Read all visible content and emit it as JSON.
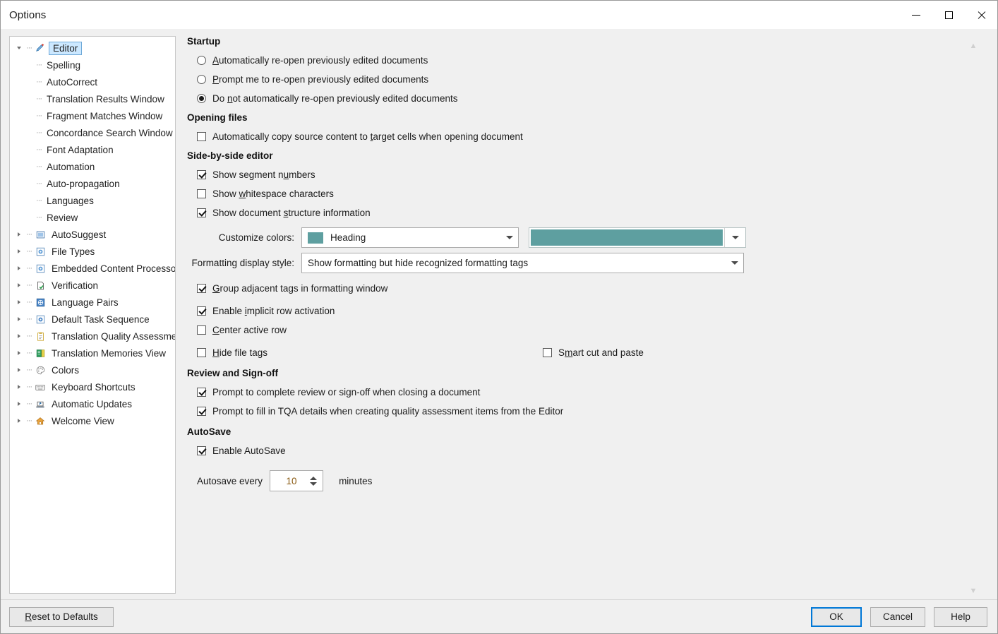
{
  "window": {
    "title": "Options",
    "minimize_label": "Minimize",
    "maximize_label": "Maximize",
    "close_label": "Close"
  },
  "sidebar": {
    "items": [
      {
        "label": "Editor",
        "icon": "pencil-icon",
        "level": 0,
        "state": "expanded",
        "selected": true
      },
      {
        "label": "Spelling",
        "icon": "none",
        "level": 1,
        "state": "leaf",
        "selected": false
      },
      {
        "label": "AutoCorrect",
        "icon": "none",
        "level": 1,
        "state": "leaf",
        "selected": false
      },
      {
        "label": "Translation Results Window",
        "icon": "none",
        "level": 1,
        "state": "leaf",
        "selected": false
      },
      {
        "label": "Fragment Matches Window",
        "icon": "none",
        "level": 1,
        "state": "leaf",
        "selected": false
      },
      {
        "label": "Concordance Search Window",
        "icon": "none",
        "level": 1,
        "state": "leaf",
        "selected": false
      },
      {
        "label": "Font Adaptation",
        "icon": "none",
        "level": 1,
        "state": "leaf",
        "selected": false
      },
      {
        "label": "Automation",
        "icon": "none",
        "level": 1,
        "state": "leaf",
        "selected": false
      },
      {
        "label": "Auto-propagation",
        "icon": "none",
        "level": 1,
        "state": "leaf",
        "selected": false
      },
      {
        "label": "Languages",
        "icon": "none",
        "level": 1,
        "state": "leaf",
        "selected": false
      },
      {
        "label": "Review",
        "icon": "none",
        "level": 1,
        "state": "leaf",
        "selected": false
      },
      {
        "label": "AutoSuggest",
        "icon": "autosuggest-icon",
        "level": 0,
        "state": "collapsed",
        "selected": false
      },
      {
        "label": "File Types",
        "icon": "file-types-icon",
        "level": 0,
        "state": "collapsed",
        "selected": false
      },
      {
        "label": "Embedded Content Processor",
        "icon": "embedded-content-icon",
        "level": 0,
        "state": "collapsed",
        "selected": false
      },
      {
        "label": "Verification",
        "icon": "verification-icon",
        "level": 0,
        "state": "collapsed",
        "selected": false
      },
      {
        "label": "Language Pairs",
        "icon": "language-pairs-icon",
        "level": 0,
        "state": "collapsed",
        "selected": false
      },
      {
        "label": "Default Task Sequence",
        "icon": "task-sequence-icon",
        "level": 0,
        "state": "collapsed",
        "selected": false
      },
      {
        "label": "Translation Quality Assessmen",
        "icon": "tqa-icon",
        "level": 0,
        "state": "collapsed",
        "selected": false
      },
      {
        "label": "Translation Memories View",
        "icon": "tm-view-icon",
        "level": 0,
        "state": "collapsed",
        "selected": false
      },
      {
        "label": "Colors",
        "icon": "palette-icon",
        "level": 0,
        "state": "collapsed",
        "selected": false
      },
      {
        "label": "Keyboard Shortcuts",
        "icon": "keyboard-icon",
        "level": 0,
        "state": "collapsed",
        "selected": false
      },
      {
        "label": "Automatic Updates",
        "icon": "updates-icon",
        "level": 0,
        "state": "collapsed",
        "selected": false
      },
      {
        "label": "Welcome View",
        "icon": "home-icon",
        "level": 0,
        "state": "collapsed",
        "selected": false
      }
    ]
  },
  "content": {
    "startup": {
      "heading": "Startup",
      "options": [
        {
          "pre": "",
          "accel": "A",
          "post": "utomatically re-open previously edited documents",
          "checked": false
        },
        {
          "pre": "",
          "accel": "P",
          "post": "rompt me to re-open previously edited documents",
          "checked": false
        },
        {
          "pre": "Do ",
          "accel": "n",
          "post": "ot automatically re-open previously edited documents",
          "checked": true
        }
      ]
    },
    "opening_files": {
      "heading": "Opening files",
      "options": [
        {
          "pre": "Automatically copy source content to ",
          "accel": "t",
          "post": "arget cells when opening document",
          "checked": false
        }
      ]
    },
    "side_by_side": {
      "heading": "Side-by-side editor",
      "options": [
        {
          "pre": "Show segment n",
          "accel": "u",
          "post": "mbers",
          "checked": true
        },
        {
          "pre": "Show ",
          "accel": "w",
          "post": "hitespace characters",
          "checked": false
        },
        {
          "pre": "Show document ",
          "accel": "s",
          "post": "tructure information",
          "checked": true
        }
      ],
      "customize_colors_label": "Customize colors:",
      "customize_colors_value": "Heading",
      "customize_colors_swatch": "#5e9fa0",
      "color_picker_value": "#5e9fa0",
      "formatting_display_label": "Formatting display style:",
      "formatting_display_value": "Show formatting but hide recognized formatting tags",
      "options2": [
        {
          "pre": "",
          "accel": "G",
          "post": "roup adjacent tags in formatting window",
          "checked": true
        },
        {
          "pre": "Enable ",
          "accel": "i",
          "post": "mplicit row activation",
          "checked": true
        },
        {
          "pre": "",
          "accel": "C",
          "post": "enter active row",
          "checked": false
        },
        {
          "pre": "",
          "accel": "H",
          "post": "ide file tags",
          "checked": false
        }
      ],
      "smart_cut_paste": {
        "pre": "S",
        "accel": "m",
        "post": "art cut and paste",
        "checked": false
      }
    },
    "review_signoff": {
      "heading": "Review and Sign-off",
      "options": [
        {
          "pre": "Prompt to complete review or sign-off when closing a document",
          "accel": "",
          "post": "",
          "checked": true
        },
        {
          "pre": "Prompt to fill in TQA details when creating quality assessment items from the Editor",
          "accel": "",
          "post": "",
          "checked": true
        }
      ]
    },
    "autosave": {
      "heading": "AutoSave",
      "enable_label": "Enable AutoSave",
      "enable_checked": true,
      "every_label": "Autosave every",
      "interval_value": "10",
      "minutes_label": "minutes"
    }
  },
  "footer": {
    "reset_label": "Reset to Defaults",
    "reset_accel_pre": "",
    "reset_accel": "R",
    "reset_accel_post": "eset to Defaults",
    "ok_label": "OK",
    "cancel_label": "Cancel",
    "help_label": "Help"
  }
}
